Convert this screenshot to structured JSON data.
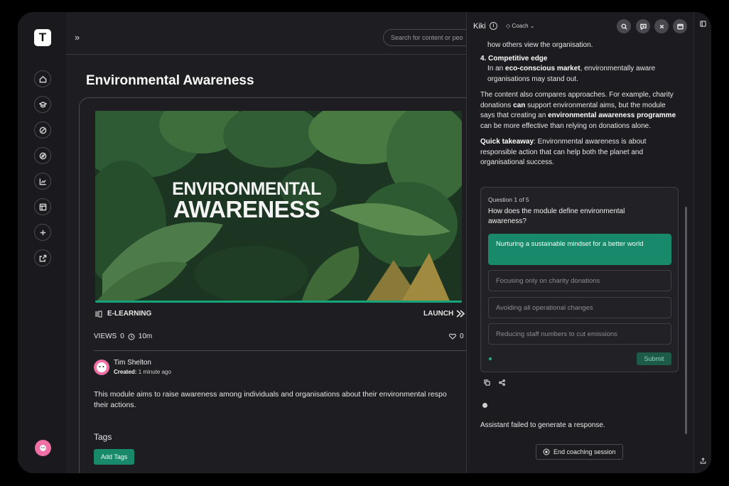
{
  "topbar": {
    "search_placeholder": "Search for content or peo"
  },
  "page": {
    "title": "Environmental Awareness"
  },
  "hero": {
    "title_line1": "ENVIRONMENTAL",
    "title_line2": "AWARENESS"
  },
  "module": {
    "type": "E-LEARNING",
    "launch_label": "LAUNCH",
    "views_label": "VIEWS",
    "views": "0",
    "duration": "10m",
    "likes": "0",
    "author": "Tim Shelton",
    "created_label": "Created:",
    "created_value": "1 minute ago",
    "description": "This module aims to raise awareness among individuals and organisations about their environmental respo",
    "description_line2": "their actions.",
    "tags_label": "Tags",
    "add_tags": "Add Tags"
  },
  "coach": {
    "name": "Kiki",
    "mode": "Coach",
    "chat": {
      "prev_line": "how others view the organisation.",
      "item4_title": "4. Competitive edge",
      "item4_pre": "In an ",
      "item4_bold": "eco-conscious market",
      "item4_post": ", environmentally aware organisations may stand out.",
      "p1_a": "The content also compares approaches. For example, charity donations ",
      "p1_b": "can",
      "p1_c": " support environmental aims, but the module says that creating an ",
      "p1_d": "environmental awareness programme",
      "p1_e": " can be more effective than relying on donations alone.",
      "takeaway_label": "Quick takeaway",
      "takeaway_text": ": Environmental awareness is about responsible action that can help both the planet and organisational success."
    },
    "quiz": {
      "counter": "Question 1 of 5",
      "question": "How does the module define environmental awareness?",
      "options": [
        "Nurturing a sustainable mindset for a better world",
        "Focusing only on charity donations",
        "Avoiding all operational changes",
        "Reducing staff numbers to cut emissions"
      ],
      "selected_index": 0,
      "submit": "Submit"
    },
    "failure": "Assistant failed to generate a response.",
    "end_session": "End coaching session"
  },
  "colors": {
    "accent": "#18896a",
    "avatar": "#f06fa5",
    "background": "#1e1e22"
  }
}
